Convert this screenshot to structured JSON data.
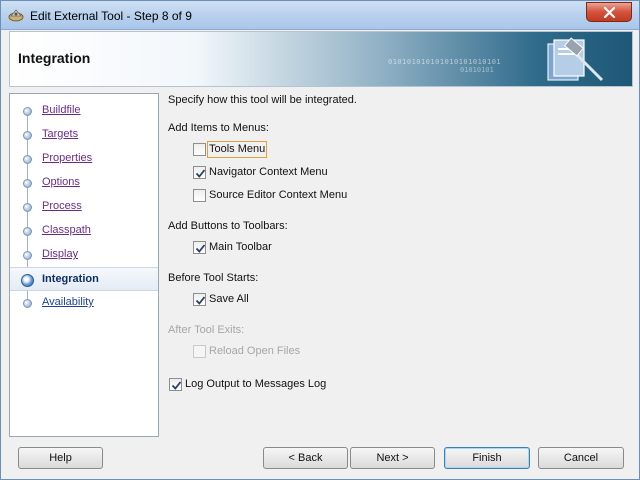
{
  "window": {
    "title": "Edit External Tool - Step 8 of 9"
  },
  "header": {
    "title": "Integration",
    "binary_line_1": "010101010101010101010101",
    "binary_line_2": "01010101"
  },
  "nav": {
    "items": [
      {
        "label": "Buildfile"
      },
      {
        "label": "Targets"
      },
      {
        "label": "Properties"
      },
      {
        "label": "Options"
      },
      {
        "label": "Process"
      },
      {
        "label": "Classpath"
      },
      {
        "label": "Display"
      },
      {
        "label": "Integration",
        "active": true
      },
      {
        "label": "Availability"
      }
    ]
  },
  "content": {
    "intro": "Specify how this tool will be integrated.",
    "menus_heading": "Add Items to Menus:",
    "tools_menu": {
      "label": "Tools Menu",
      "checked": false
    },
    "navigator_menu": {
      "label": "Navigator Context Menu",
      "checked": true
    },
    "source_editor_menu": {
      "label": "Source Editor Context Menu",
      "checked": false
    },
    "toolbars_heading": "Add Buttons to Toolbars:",
    "main_toolbar": {
      "label": "Main Toolbar",
      "checked": true
    },
    "before_heading": "Before Tool Starts:",
    "save_all": {
      "label": "Save All",
      "checked": true
    },
    "after_heading": "After Tool Exits:",
    "reload_files": {
      "label": "Reload Open Files",
      "checked": false,
      "disabled": true
    },
    "log_output": {
      "label": "Log Output to Messages Log",
      "checked": true
    }
  },
  "buttons": {
    "help": "Help",
    "back": "< Back",
    "next": "Next >",
    "finish": "Finish",
    "cancel": "Cancel"
  },
  "icons": {
    "app": "tool-gear-icon",
    "close": "close-icon",
    "header_logo": "wizard-hammer-icon"
  }
}
